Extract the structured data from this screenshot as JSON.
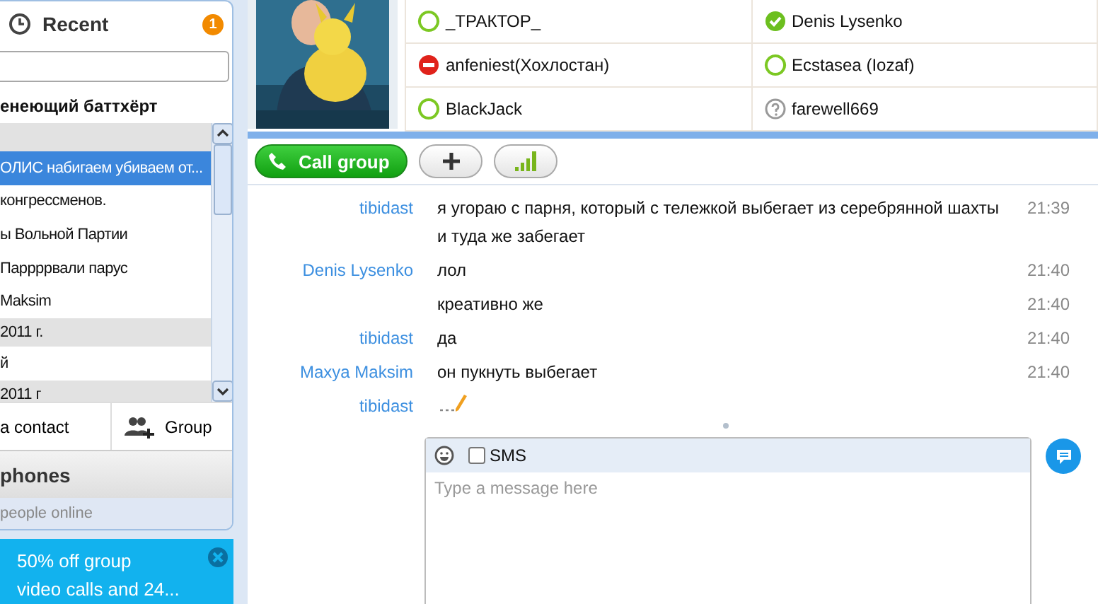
{
  "sidebar": {
    "title": "Recent",
    "badge": "1",
    "group_title": "енеющий баттхёрт",
    "items": [
      {
        "kind": "date",
        "selected": false
      },
      {
        "kind": "chat",
        "label": "ОЛИС набигаем убиваем от...",
        "selected": true
      },
      {
        "kind": "chat",
        "label": "конгрессменов.",
        "selected": false
      },
      {
        "kind": "chat",
        "label": "ы Вольной Партии",
        "selected": false
      },
      {
        "kind": "chat",
        "label": "Паррррвали парус",
        "selected": false
      },
      {
        "kind": "chat",
        "label": "Maksim",
        "selected": false
      },
      {
        "kind": "date",
        "label": "2011 г.",
        "selected": false
      },
      {
        "kind": "chat",
        "label": "й",
        "selected": false
      },
      {
        "kind": "date",
        "label": "2011 г",
        "selected": false
      }
    ],
    "actions": [
      {
        "kind": "contact",
        "label": "a contact"
      },
      {
        "kind": "group",
        "label": "Group"
      }
    ],
    "phones_title": "phones",
    "online_text": "people online",
    "promo": {
      "lines": [
        "50% off group",
        "video calls and 24..."
      ]
    }
  },
  "participants": [
    {
      "name": "_ТРАКТОР_",
      "kind": "online"
    },
    {
      "name": "Denis Lysenko",
      "kind": "contact"
    },
    {
      "name": "anfeniest(Хохлостан)",
      "kind": "busy"
    },
    {
      "name": "Ecstasea (Iozaf)",
      "kind": "online"
    },
    {
      "name": "BlackJack",
      "kind": "online"
    },
    {
      "name": "farewell669",
      "kind": "unknown"
    }
  ],
  "toolbar": {
    "call_label": "Call group"
  },
  "messages": [
    {
      "kind": "message",
      "sender": "tibidast",
      "text": "я угораю с парня, который с тележкой выбегает из серебрянной шахты и туда же забегает",
      "time": "21:39"
    },
    {
      "kind": "message",
      "sender": "Denis Lysenko",
      "text": "лол",
      "time": "21:40"
    },
    {
      "kind": "message",
      "text": "креативно же",
      "time": "21:40"
    },
    {
      "kind": "message",
      "sender": "tibidast",
      "text": "да",
      "time": "21:40"
    },
    {
      "kind": "message",
      "sender": "Maxya Maksim",
      "text": "он пукнуть выбегает",
      "time": "21:40"
    },
    {
      "kind": "typing",
      "sender": "tibidast"
    }
  ],
  "composer": {
    "placeholder": "Type a message here",
    "sms": {
      "label": "SMS",
      "checked": false
    }
  }
}
